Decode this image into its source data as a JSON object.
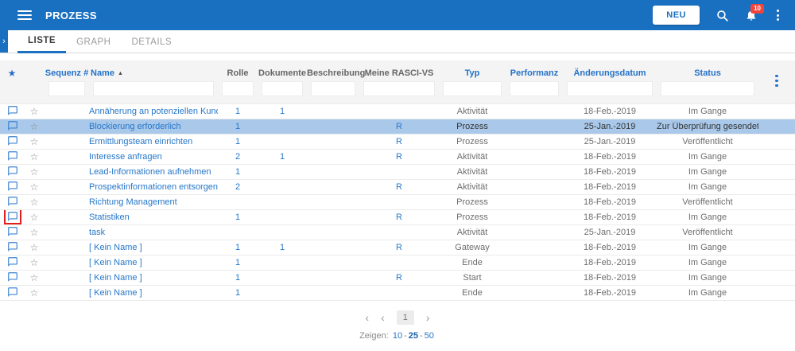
{
  "app_bar": {
    "title": "PROZESS",
    "new_button_label": "NEU",
    "notification_count": "10"
  },
  "tabs": [
    {
      "label": "LISTE",
      "active": true
    },
    {
      "label": "GRAPH",
      "active": false
    },
    {
      "label": "DETAILS",
      "active": false
    }
  ],
  "table": {
    "columns": [
      {
        "key": "sequenz",
        "label": "Sequenz #",
        "color": "blue"
      },
      {
        "key": "name",
        "label": "Name",
        "color": "blue",
        "sorted": "asc"
      },
      {
        "key": "rolle",
        "label": "Rolle",
        "color": "gray"
      },
      {
        "key": "dokumente",
        "label": "Dokumente",
        "color": "gray"
      },
      {
        "key": "beschreibung",
        "label": "Beschreibung",
        "color": "gray"
      },
      {
        "key": "rasci",
        "label": "Meine RASCI-VS",
        "color": "gray"
      },
      {
        "key": "typ",
        "label": "Typ",
        "color": "blue"
      },
      {
        "key": "performanz",
        "label": "Performanz",
        "color": "blue"
      },
      {
        "key": "datum",
        "label": "Änderungsdatum",
        "color": "blue"
      },
      {
        "key": "status",
        "label": "Status",
        "color": "blue"
      }
    ],
    "rows": [
      {
        "name": "Annäherung an potenziellen Kunden",
        "rolle": "1",
        "dokumente": "1",
        "rasci": "",
        "typ": "Aktivität",
        "datum": "18-Feb.-2019",
        "status": "Im Gange"
      },
      {
        "name": "Blockierung erforderlich",
        "rolle": "1",
        "dokumente": "",
        "rasci": "R",
        "typ": "Prozess",
        "datum": "25-Jan.-2019",
        "status": "Zur Überprüfung gesendet",
        "highlighted": true
      },
      {
        "name": "Ermittlungsteam einrichten",
        "rolle": "1",
        "dokumente": "",
        "rasci": "R",
        "typ": "Prozess",
        "datum": "25-Jan.-2019",
        "status": "Veröffentlicht"
      },
      {
        "name": "Interesse anfragen",
        "rolle": "2",
        "dokumente": "1",
        "rasci": "R",
        "typ": "Aktivität",
        "datum": "18-Feb.-2019",
        "status": "Im Gange"
      },
      {
        "name": "Lead-Informationen aufnehmen",
        "rolle": "1",
        "dokumente": "",
        "rasci": "",
        "typ": "Aktivität",
        "datum": "18-Feb.-2019",
        "status": "Im Gange"
      },
      {
        "name": "Prospektinformationen entsorgen",
        "rolle": "2",
        "dokumente": "",
        "rasci": "R",
        "typ": "Aktivität",
        "datum": "18-Feb.-2019",
        "status": "Im Gange"
      },
      {
        "name": "Richtung Management",
        "rolle": "",
        "dokumente": "",
        "rasci": "",
        "typ": "Prozess",
        "datum": "18-Feb.-2019",
        "status": "Veröffentlicht"
      },
      {
        "name": "Statistiken",
        "rolle": "1",
        "dokumente": "",
        "rasci": "R",
        "typ": "Prozess",
        "datum": "18-Feb.-2019",
        "status": "Im Gange",
        "annotated": true
      },
      {
        "name": "task",
        "rolle": "",
        "dokumente": "",
        "rasci": "",
        "typ": "Aktivität",
        "datum": "25-Jan.-2019",
        "status": "Veröffentlicht"
      },
      {
        "name": "[ Kein Name ]",
        "rolle": "1",
        "dokumente": "1",
        "rasci": "R",
        "typ": "Gateway",
        "datum": "18-Feb.-2019",
        "status": "Im Gange"
      },
      {
        "name": "[ Kein Name ]",
        "rolle": "1",
        "dokumente": "",
        "rasci": "",
        "typ": "Ende",
        "datum": "18-Feb.-2019",
        "status": "Im Gange"
      },
      {
        "name": "[ Kein Name ]",
        "rolle": "1",
        "dokumente": "",
        "rasci": "R",
        "typ": "Start",
        "datum": "18-Feb.-2019",
        "status": "Im Gange"
      },
      {
        "name": "[ Kein Name ]",
        "rolle": "1",
        "dokumente": "",
        "rasci": "",
        "typ": "Ende",
        "datum": "18-Feb.-2019",
        "status": "Im Gange"
      }
    ]
  },
  "pagination": {
    "first_glyph": "‹",
    "prev_glyph": "‹",
    "next_glyph": "›",
    "current_page": "1"
  },
  "page_size": {
    "label": "Zeigen:",
    "options": [
      "10",
      "25",
      "50"
    ],
    "selected": "25",
    "separator": "-"
  },
  "icons": {
    "favorite_header": "★",
    "favorite_row": "☆",
    "sort_asc": "▲",
    "sidebar_expand": "›"
  },
  "colors": {
    "app_bar_blue": "#1a70c0",
    "link_blue": "#2677c9",
    "header_label_blue": "#2472c8",
    "header_label_gray": "#666666",
    "row_highlight": "#a9c8ea",
    "badge_red": "#f4433a",
    "annotation_red": "#e21d1d",
    "filter_area_gray": "#f4f4f4"
  }
}
